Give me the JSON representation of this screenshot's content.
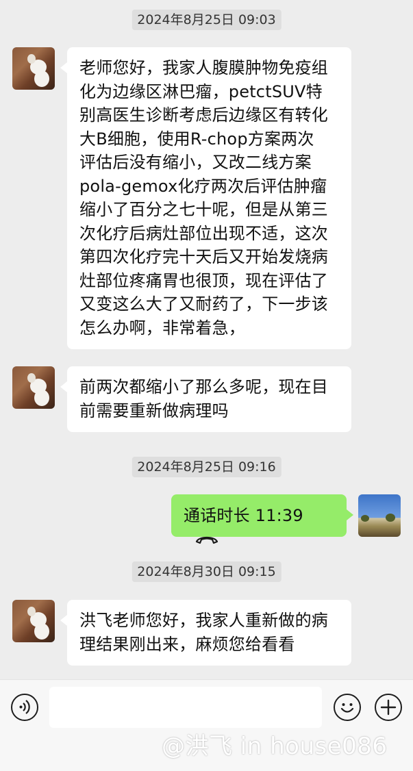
{
  "timestamps": [
    "2024年8月25日 09:03",
    "2024年8月25日 09:16",
    "2024年8月30日 09:15"
  ],
  "messages": [
    {
      "direction": "in",
      "lines": [
        "老师您好，我家人腹膜肿物免疫组",
        "化为边缘区淋巴瘤，petctSUV特",
        "别高医生诊断考虑后边缘区有转化",
        "大B细胞，使用R-chop方案两次",
        "评估后没有缩小，又改二线方案",
        "pola-gemox化疗两次后评估肿瘤",
        "缩小了百分之七十呢，但是从第三",
        "次化疗后病灶部位出现不适，这次",
        "第四次化疗完十天后又开始发烧病",
        "灶部位疼痛胃也很顶，现在评估了",
        "又变这么大了又耐药了，下一步该",
        "怎么办啊，非常着急，"
      ]
    },
    {
      "direction": "in",
      "lines": [
        "前两次都缩小了那么多呢，现在目",
        "前需要重新做病理吗"
      ]
    },
    {
      "direction": "out",
      "text": "通话时长 11:39",
      "icon": "phone-hangup-icon"
    },
    {
      "direction": "in",
      "lines": [
        "洪飞老师您好，我家人重新做的病",
        "理结果刚出来，麻烦您给看看"
      ]
    }
  ],
  "input_bar": {
    "voice_icon": "voice-icon",
    "emoji_icon": "emoji-icon",
    "plus_icon": "plus-icon",
    "input_value": ""
  },
  "watermark": "@洪飞 in house086",
  "colors": {
    "background": "#ededed",
    "incoming_bubble": "#ffffff",
    "outgoing_bubble": "#95ec69",
    "timestamp_bg": "#dedede"
  }
}
